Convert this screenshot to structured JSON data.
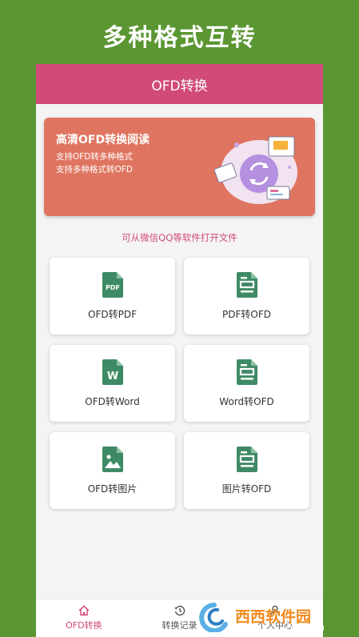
{
  "promo": {
    "title": "多种格式互转"
  },
  "app": {
    "title": "OFD转换"
  },
  "banner": {
    "title": "高清OFD转换阅读",
    "line1": "支持OFD转多种格式",
    "line2": "支持多种格式转OFD"
  },
  "hint": "可从微信QQ等软件打开文件",
  "cards": [
    {
      "label": "OFD转PDF",
      "icon": "pdf-file-icon"
    },
    {
      "label": "PDF转OFD",
      "icon": "ofd-file-icon"
    },
    {
      "label": "OFD转Word",
      "icon": "word-file-icon"
    },
    {
      "label": "Word转OFD",
      "icon": "ofd-file-icon"
    },
    {
      "label": "OFD转图片",
      "icon": "image-file-icon"
    },
    {
      "label": "图片转OFD",
      "icon": "ofd-file-icon"
    }
  ],
  "nav": {
    "items": [
      {
        "label": "OFD转换",
        "icon": "home-icon"
      },
      {
        "label": "转换记录",
        "icon": "history-icon"
      },
      {
        "label": "个人中心",
        "icon": "user-icon"
      }
    ]
  },
  "watermark": {
    "text": "西西软件园",
    "sub": "CR173.COM"
  },
  "colors": {
    "green": "#5a9632",
    "accent": "#d14a79",
    "banner": "#df7560",
    "icon": "#3f8a66"
  }
}
